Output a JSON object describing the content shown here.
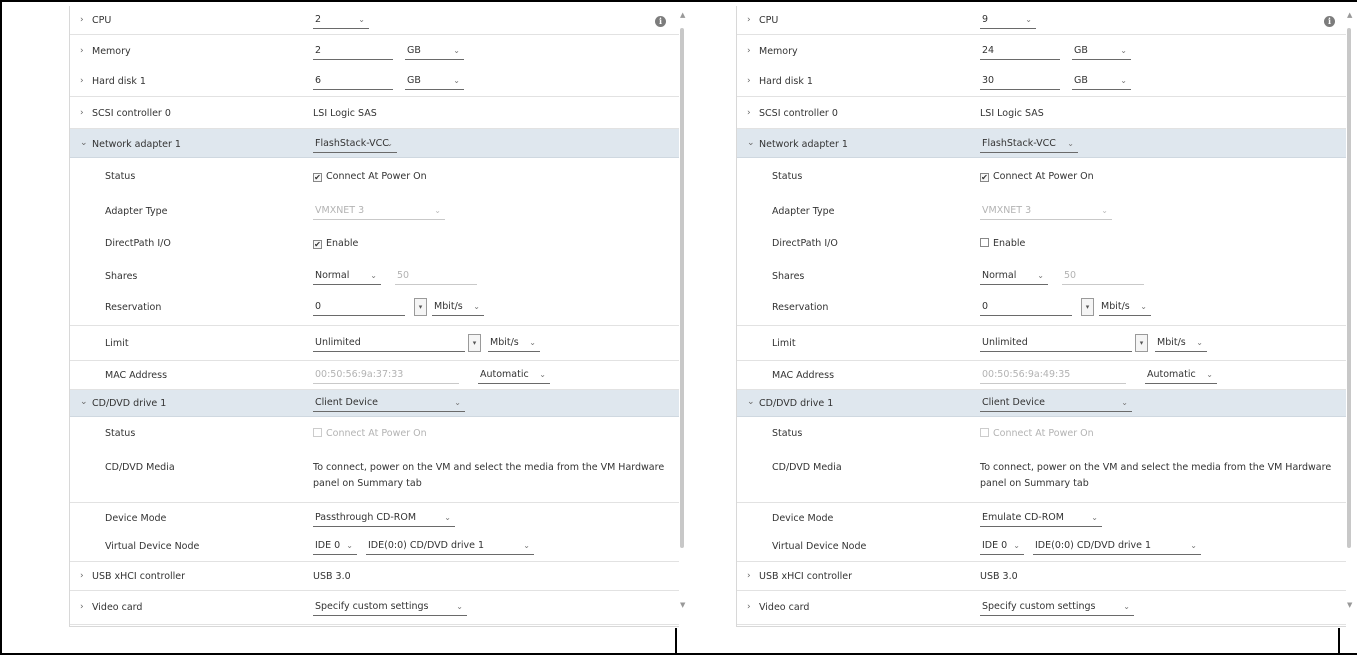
{
  "left": {
    "cpu": {
      "label": "CPU",
      "value": "2"
    },
    "memory": {
      "label": "Memory",
      "value": "2",
      "unit": "GB"
    },
    "hard_disk": {
      "label": "Hard disk 1",
      "value": "6",
      "unit": "GB"
    },
    "scsi": {
      "label": "SCSI controller 0",
      "value": "LSI Logic SAS"
    },
    "network": {
      "label": "Network adapter 1",
      "value": "FlashStack-VCC"
    },
    "status": {
      "label": "Status",
      "checkbox": "Connect At Power On"
    },
    "adapter_type": {
      "label": "Adapter Type",
      "value": "VMXNET 3"
    },
    "directpath": {
      "label": "DirectPath I/O",
      "checkbox": "Enable",
      "checked": true
    },
    "shares": {
      "label": "Shares",
      "value": "Normal",
      "number": "50"
    },
    "reservation": {
      "label": "Reservation",
      "value": "0",
      "unit": "Mbit/s"
    },
    "limit": {
      "label": "Limit",
      "value": "Unlimited",
      "unit": "Mbit/s"
    },
    "mac": {
      "label": "MAC Address",
      "value": "00:50:56:9a:37:33",
      "mode": "Automatic"
    },
    "cddvd": {
      "label": "CD/DVD drive 1",
      "value": "Client Device"
    },
    "cd_status": {
      "label": "Status",
      "checkbox": "Connect At Power On"
    },
    "cd_media": {
      "label": "CD/DVD Media",
      "text": "To connect, power on the VM and select the media from the VM Hardware panel on Summary tab"
    },
    "device_mode": {
      "label": "Device Mode",
      "value": "Passthrough CD-ROM"
    },
    "vdn": {
      "label": "Virtual Device Node",
      "bus": "IDE 0",
      "node": "IDE(0:0) CD/DVD drive 1"
    },
    "usb": {
      "label": "USB xHCI controller",
      "value": "USB 3.0"
    },
    "video": {
      "label": "Video card",
      "value": "Specify custom settings"
    }
  },
  "right": {
    "cpu": {
      "label": "CPU",
      "value": "9"
    },
    "memory": {
      "label": "Memory",
      "value": "24",
      "unit": "GB"
    },
    "hard_disk": {
      "label": "Hard disk 1",
      "value": "30",
      "unit": "GB"
    },
    "scsi": {
      "label": "SCSI controller 0",
      "value": "LSI Logic SAS"
    },
    "network": {
      "label": "Network adapter 1",
      "value": "FlashStack-VCC"
    },
    "status": {
      "label": "Status",
      "checkbox": "Connect At Power On"
    },
    "adapter_type": {
      "label": "Adapter Type",
      "value": "VMXNET 3"
    },
    "directpath": {
      "label": "DirectPath I/O",
      "checkbox": "Enable",
      "checked": false
    },
    "shares": {
      "label": "Shares",
      "value": "Normal",
      "number": "50"
    },
    "reservation": {
      "label": "Reservation",
      "value": "0",
      "unit": "Mbit/s"
    },
    "limit": {
      "label": "Limit",
      "value": "Unlimited",
      "unit": "Mbit/s"
    },
    "mac": {
      "label": "MAC Address",
      "value": "00:50:56:9a:49:35",
      "mode": "Automatic"
    },
    "cddvd": {
      "label": "CD/DVD drive 1",
      "value": "Client Device"
    },
    "cd_status": {
      "label": "Status",
      "checkbox": "Connect At Power On"
    },
    "cd_media": {
      "label": "CD/DVD Media",
      "text": "To connect, power on the VM and select the media from the VM Hardware panel on Summary tab"
    },
    "device_mode": {
      "label": "Device Mode",
      "value": "Emulate CD-ROM"
    },
    "vdn": {
      "label": "Virtual Device Node",
      "bus": "IDE 0",
      "node": "IDE(0:0) CD/DVD drive 1"
    },
    "usb": {
      "label": "USB xHCI controller",
      "value": "USB 3.0"
    },
    "video": {
      "label": "Video card",
      "value": "Specify custom settings"
    }
  },
  "icons": {
    "info": "i",
    "chevron_right": "›",
    "chevron_down": "⌄",
    "caret": "⌄",
    "check": "✔",
    "dropdown_arrow": "▾"
  },
  "colors": {
    "section_bg": "#dfe7ee",
    "disabled_text": "#b3b3b3"
  }
}
